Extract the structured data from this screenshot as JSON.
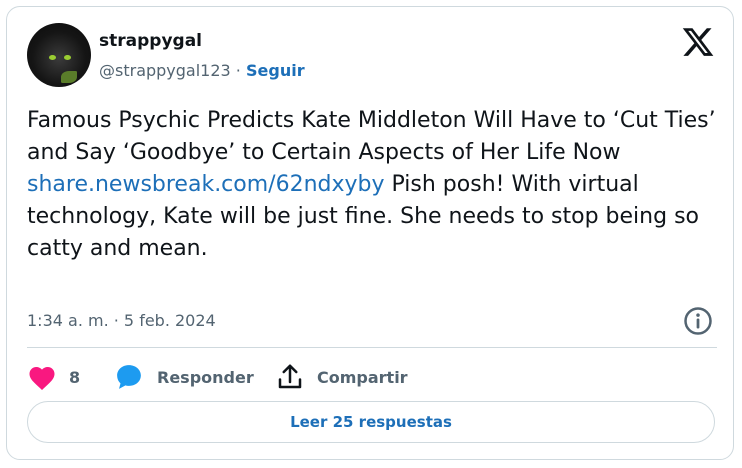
{
  "author": {
    "name": "strappygal",
    "handle": "@strappygal123",
    "separator": " · ",
    "follow_label": "Seguir"
  },
  "tweet": {
    "text_before_link": "Famous Psychic Predicts Kate Middleton Will Have to ‘Cut Ties’ and Say ‘Goodbye’ to Certain Aspects of Her Life Now",
    "link": "share.newsbreak.com/62ndxyby",
    "text_after_link": " Pish posh! With virtual technology, Kate will be just fine. She needs to stop being so catty and mean.",
    "timestamp": "1:34 a. m. · 5 feb. 2024"
  },
  "actions": {
    "like_count": "8",
    "reply_label": "Responder",
    "share_label": "Compartir",
    "read_replies_label": "Leer 25 respuestas"
  },
  "colors": {
    "link": "#1d6fb8",
    "like": "#f91880",
    "reply_bubble": "#1d9bf0",
    "muted": "#536471"
  },
  "icons": [
    "x-logo-icon",
    "info-icon",
    "heart-icon",
    "reply-bubble-icon",
    "share-upload-icon"
  ]
}
